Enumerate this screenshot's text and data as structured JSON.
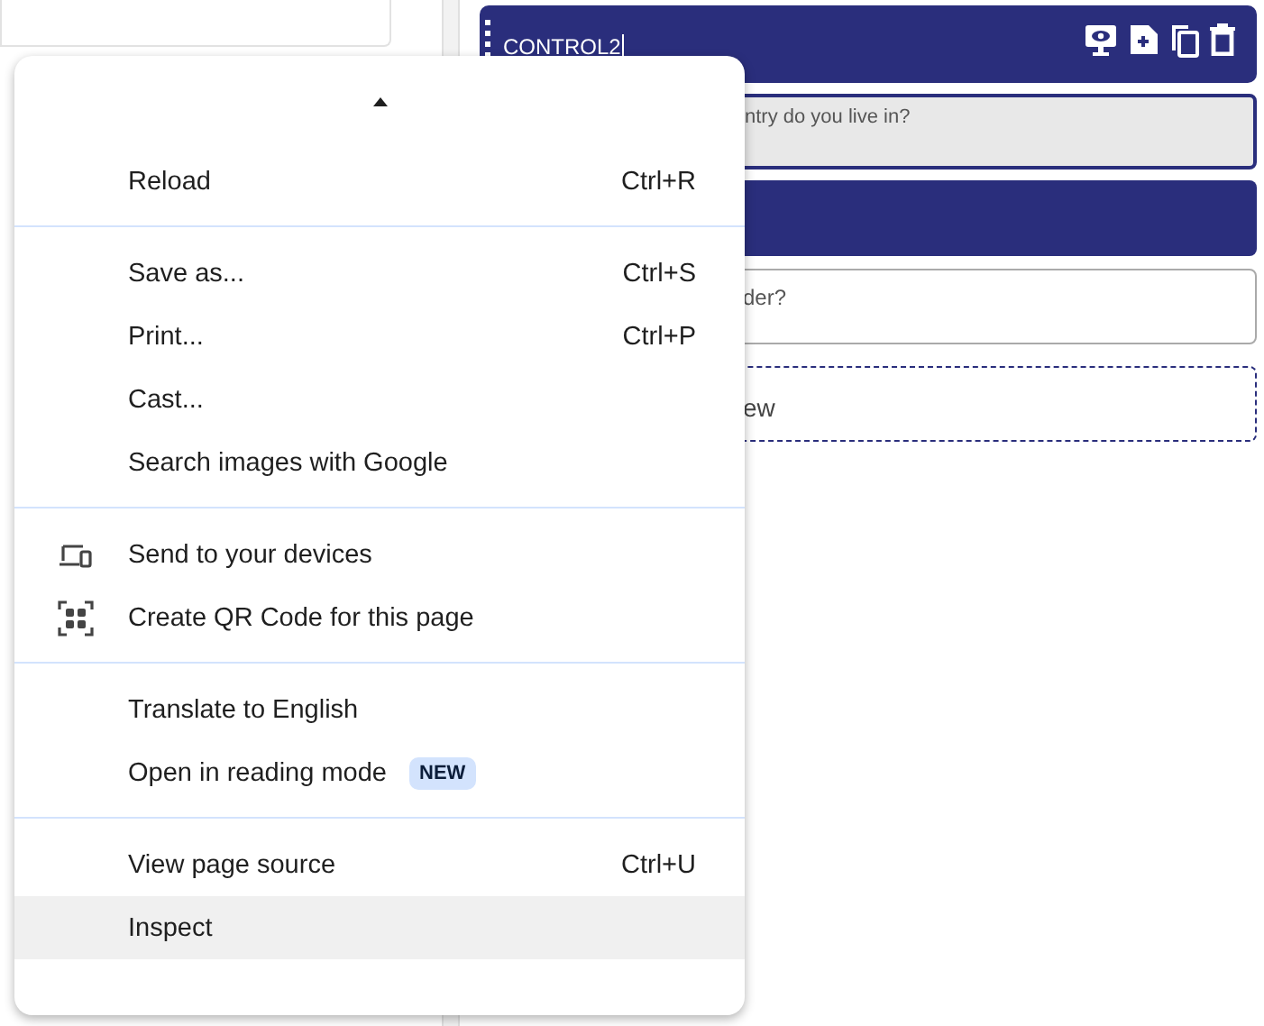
{
  "editor": {
    "control_header": {
      "title": "CONTROL2"
    },
    "blocks": [
      {
        "kind": "question",
        "text": "ntry do you live in?"
      },
      {
        "kind": "bar"
      },
      {
        "kind": "input",
        "text": "der?"
      },
      {
        "kind": "add",
        "text": "ew"
      }
    ]
  },
  "context_menu": {
    "groups": [
      [
        {
          "kind": "plain",
          "label": "Reload",
          "shortcut": "Ctrl+R",
          "selected": false
        }
      ],
      [
        {
          "kind": "plain",
          "label": "Save as...",
          "shortcut": "Ctrl+S",
          "selected": false
        },
        {
          "kind": "plain",
          "label": "Print...",
          "shortcut": "Ctrl+P",
          "selected": false
        },
        {
          "kind": "plain",
          "label": "Cast...",
          "selected": false
        },
        {
          "kind": "plain",
          "label": "Search images with Google",
          "selected": false
        }
      ],
      [
        {
          "kind": "devices",
          "label": "Send to your devices",
          "selected": false
        },
        {
          "kind": "qrcode",
          "label": "Create QR Code for this page",
          "selected": false
        }
      ],
      [
        {
          "kind": "plain",
          "label": "Translate to English",
          "selected": false
        },
        {
          "kind": "plain",
          "label": "Open in reading mode",
          "badge": "NEW",
          "selected": false
        }
      ],
      [
        {
          "kind": "plain",
          "label": "View page source",
          "shortcut": "Ctrl+U",
          "selected": false
        },
        {
          "kind": "plain",
          "label": "Inspect",
          "selected": true
        }
      ]
    ]
  }
}
